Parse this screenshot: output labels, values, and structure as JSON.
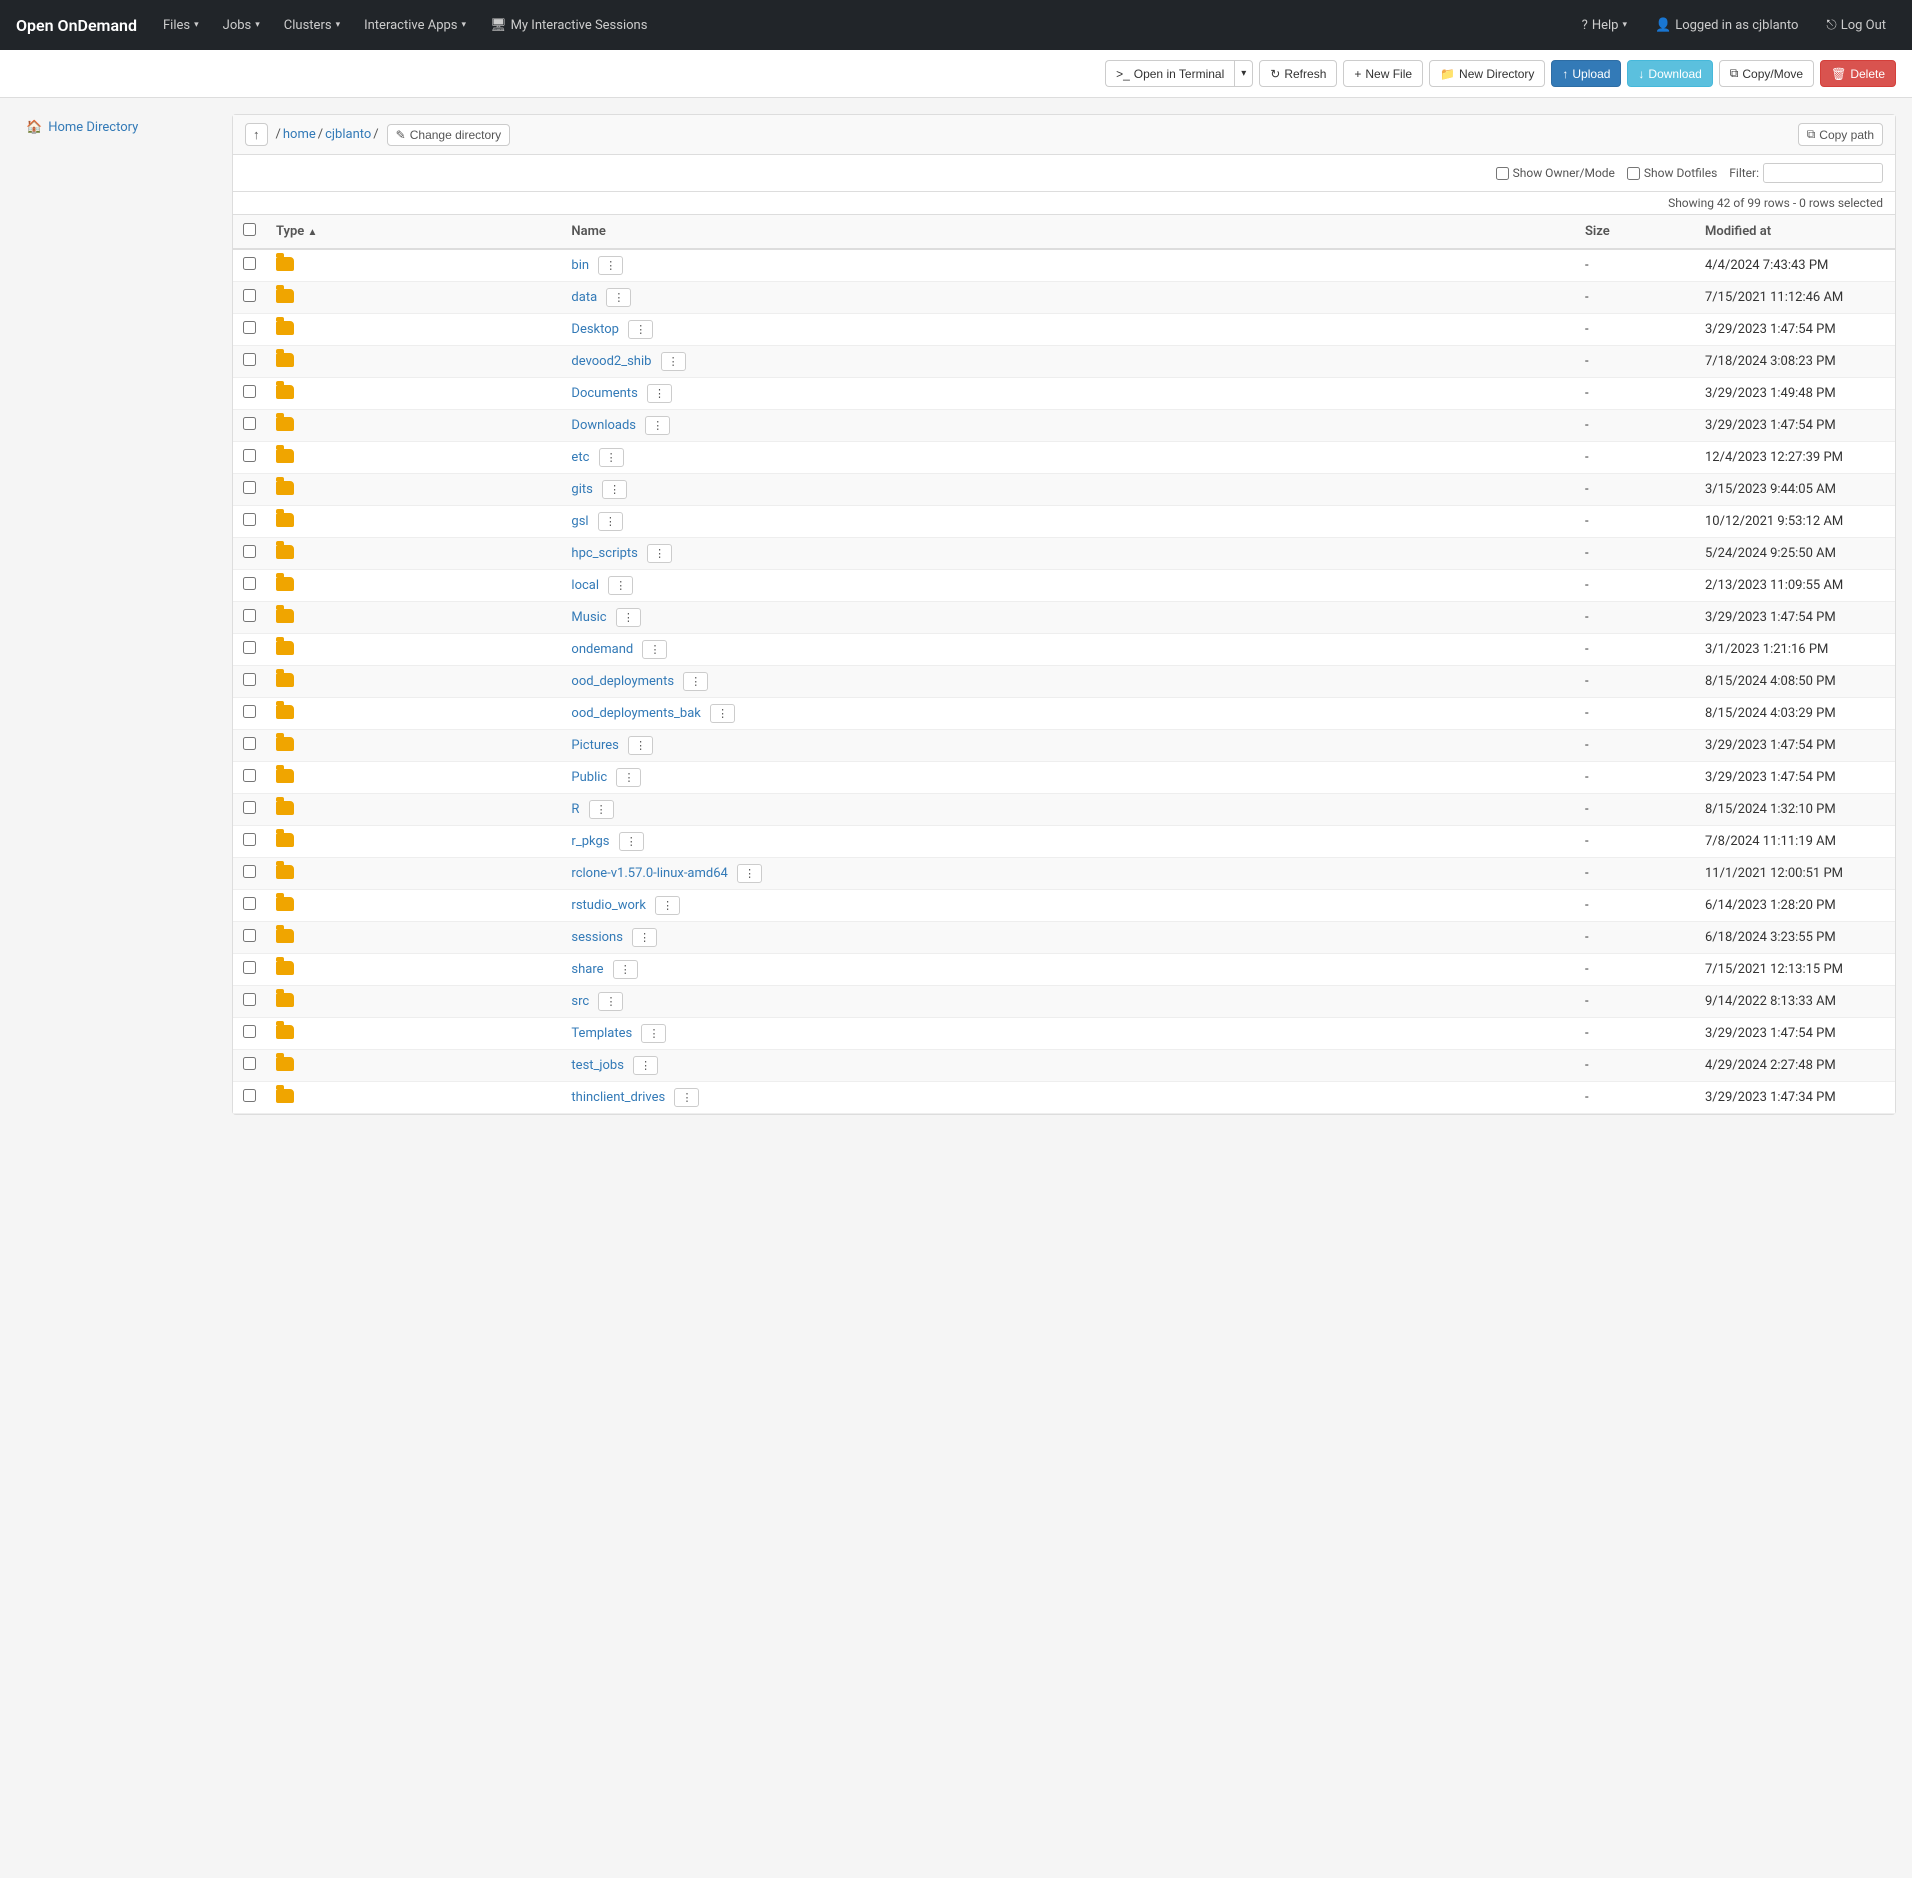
{
  "app": {
    "brand": "Open OnDemand"
  },
  "navbar": {
    "items": [
      {
        "label": "Files",
        "hasDropdown": true
      },
      {
        "label": "Jobs",
        "hasDropdown": true
      },
      {
        "label": "Clusters",
        "hasDropdown": true
      },
      {
        "label": "Interactive Apps",
        "hasDropdown": true
      },
      {
        "label": "My Interactive Sessions",
        "hasDropdown": false,
        "icon": "desktop"
      }
    ],
    "right": [
      {
        "label": "Help",
        "hasDropdown": true,
        "icon": "question"
      },
      {
        "label": "Logged in as cjblanto",
        "icon": "user"
      },
      {
        "label": "Log Out",
        "icon": "signout"
      }
    ]
  },
  "toolbar": {
    "open_terminal_label": "Open in Terminal",
    "refresh_label": "Refresh",
    "new_file_label": "New File",
    "new_directory_label": "New Directory",
    "upload_label": "Upload",
    "download_label": "Download",
    "copy_move_label": "Copy/Move",
    "delete_label": "Delete"
  },
  "sidebar": {
    "items": [
      {
        "label": "Home Directory",
        "icon": "home"
      }
    ]
  },
  "breadcrumb": {
    "up_icon": "↑",
    "path_separator": "/",
    "segments": [
      {
        "label": "home",
        "link": true
      },
      {
        "label": "cjblanto",
        "link": true
      }
    ],
    "change_dir_label": "Change directory",
    "copy_path_label": "Copy path"
  },
  "filter_bar": {
    "show_owner_mode_label": "Show Owner/Mode",
    "show_dotfiles_label": "Show Dotfiles",
    "filter_label": "Filter:",
    "filter_placeholder": "",
    "row_count": "Showing 42 of 99 rows - 0 rows selected"
  },
  "table": {
    "columns": [
      "Type",
      "Name",
      "Size",
      "Modified at"
    ],
    "rows": [
      {
        "type": "folder",
        "name": "bin",
        "size": "-",
        "modified": "4/4/2024 7:43:43 PM"
      },
      {
        "type": "folder",
        "name": "data",
        "size": "-",
        "modified": "7/15/2021 11:12:46 AM"
      },
      {
        "type": "folder",
        "name": "Desktop",
        "size": "-",
        "modified": "3/29/2023 1:47:54 PM"
      },
      {
        "type": "folder",
        "name": "devood2_shib",
        "size": "-",
        "modified": "7/18/2024 3:08:23 PM"
      },
      {
        "type": "folder",
        "name": "Documents",
        "size": "-",
        "modified": "3/29/2023 1:49:48 PM"
      },
      {
        "type": "folder",
        "name": "Downloads",
        "size": "-",
        "modified": "3/29/2023 1:47:54 PM"
      },
      {
        "type": "folder",
        "name": "etc",
        "size": "-",
        "modified": "12/4/2023 12:27:39 PM"
      },
      {
        "type": "folder",
        "name": "gits",
        "size": "-",
        "modified": "3/15/2023 9:44:05 AM"
      },
      {
        "type": "folder",
        "name": "gsl",
        "size": "-",
        "modified": "10/12/2021 9:53:12 AM"
      },
      {
        "type": "folder",
        "name": "hpc_scripts",
        "size": "-",
        "modified": "5/24/2024 9:25:50 AM"
      },
      {
        "type": "folder",
        "name": "local",
        "size": "-",
        "modified": "2/13/2023 11:09:55 AM"
      },
      {
        "type": "folder",
        "name": "Music",
        "size": "-",
        "modified": "3/29/2023 1:47:54 PM"
      },
      {
        "type": "folder",
        "name": "ondemand",
        "size": "-",
        "modified": "3/1/2023 1:21:16 PM"
      },
      {
        "type": "folder",
        "name": "ood_deployments",
        "size": "-",
        "modified": "8/15/2024 4:08:50 PM"
      },
      {
        "type": "folder",
        "name": "ood_deployments_bak",
        "size": "-",
        "modified": "8/15/2024 4:03:29 PM"
      },
      {
        "type": "folder",
        "name": "Pictures",
        "size": "-",
        "modified": "3/29/2023 1:47:54 PM"
      },
      {
        "type": "folder",
        "name": "Public",
        "size": "-",
        "modified": "3/29/2023 1:47:54 PM"
      },
      {
        "type": "folder",
        "name": "R",
        "size": "-",
        "modified": "8/15/2024 1:32:10 PM"
      },
      {
        "type": "folder",
        "name": "r_pkgs",
        "size": "-",
        "modified": "7/8/2024 11:11:19 AM"
      },
      {
        "type": "folder",
        "name": "rclone-v1.57.0-linux-amd64",
        "size": "-",
        "modified": "11/1/2021 12:00:51 PM"
      },
      {
        "type": "folder",
        "name": "rstudio_work",
        "size": "-",
        "modified": "6/14/2023 1:28:20 PM"
      },
      {
        "type": "folder",
        "name": "sessions",
        "size": "-",
        "modified": "6/18/2024 3:23:55 PM"
      },
      {
        "type": "folder",
        "name": "share",
        "size": "-",
        "modified": "7/15/2021 12:13:15 PM"
      },
      {
        "type": "folder",
        "name": "src",
        "size": "-",
        "modified": "9/14/2022 8:13:33 AM"
      },
      {
        "type": "folder",
        "name": "Templates",
        "size": "-",
        "modified": "3/29/2023 1:47:54 PM"
      },
      {
        "type": "folder",
        "name": "test_jobs",
        "size": "-",
        "modified": "4/29/2024 2:27:48 PM"
      },
      {
        "type": "folder",
        "name": "thinclient_drives",
        "size": "-",
        "modified": "3/29/2023 1:47:34 PM"
      }
    ]
  }
}
